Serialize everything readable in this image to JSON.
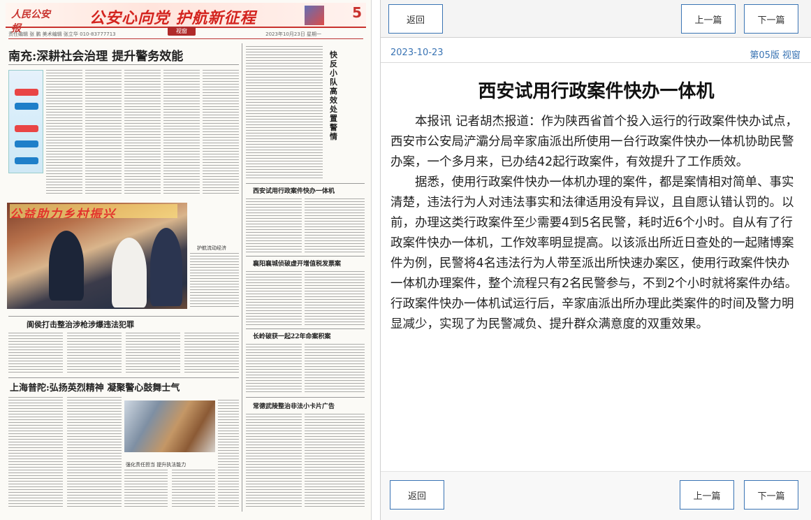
{
  "newspaper": {
    "banner_logo": "人民公安报",
    "banner_title": "公安心向党 护航新征程",
    "page_number": "5",
    "section_label": "视窗",
    "meta_left": "责任编辑 张 鹏  美术编辑 张立华  010-83777713",
    "meta_date": "2023年10月23日  星期一",
    "headlines": [
      "南充:深耕社会治理 提升警务效能",
      "阆侯打击整治涉枪涉爆违法犯罪",
      "上海普陀:弘扬英烈精神 凝聚警心鼓舞士气",
      "西安试用行政案件快办一体机",
      "襄阳襄城侦破虚开增值税发票案",
      "长岭破获一起22年命案积案",
      "常德武陵整治非法小卡片广告"
    ],
    "vertical_title": "快反小队高效处置警情",
    "photo1_banner": "公益助力乡村振兴",
    "photo1_caption": "护航流动经济",
    "photo2_caption": "强化责任担当  提升执法能力"
  },
  "viewer": {
    "buttons": {
      "back": "返回",
      "prev": "上一篇",
      "next": "下一篇"
    },
    "date": "2023-10-23",
    "edition": "第05版 视窗",
    "article": {
      "title": "西安试用行政案件快办一体机",
      "paragraphs": [
        "本报讯 记者胡杰报道：作为陕西省首个投入运行的行政案件快办试点，西安市公安局浐灞分局辛家庙派出所使用一台行政案件快办一体机协助民警办案，一个多月来，已办结42起行政案件，有效提升了工作质效。",
        "据悉，使用行政案件快办一体机办理的案件，都是案情相对简单、事实清楚，违法行为人对违法事实和法律适用没有异议，且自愿认错认罚的。以前，办理这类行政案件至少需要4到5名民警，耗时近6个小时。自从有了行政案件快办一体机，工作效率明显提高。以该派出所近日查处的一起赌博案件为例，民警将4名违法行为人带至派出所快速办案区，使用行政案件快办一体机办理案件，整个流程只有2名民警参与，不到2个小时就将案件办结。行政案件快办一体机试运行后，辛家庙派出所办理此类案件的时间及警力明显减少，实现了为民警减负、提升群众满意度的双重效果。"
      ]
    }
  },
  "colors": {
    "accent": "#3a74b4",
    "banner_red": "#d3241f"
  }
}
